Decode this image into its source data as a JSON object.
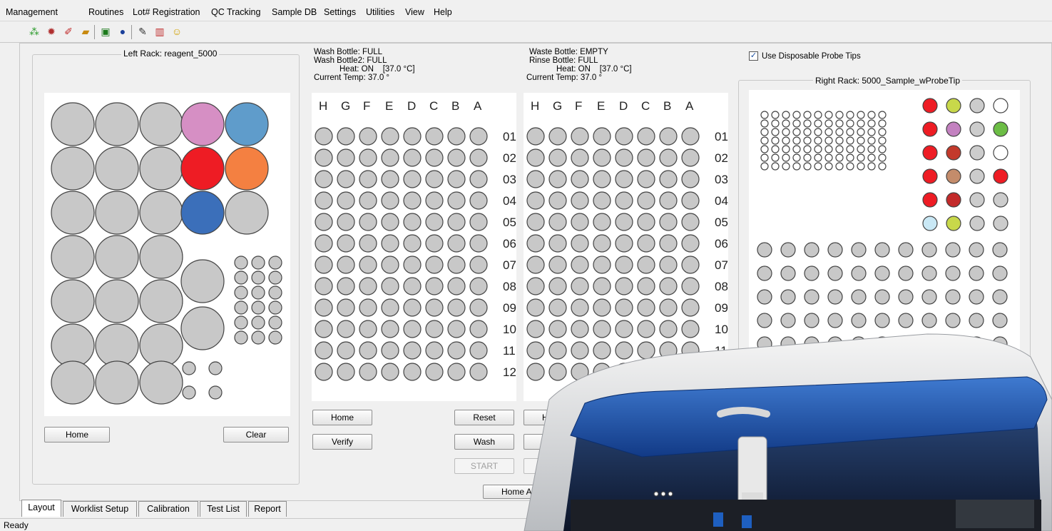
{
  "menu": [
    "Management",
    "Routines",
    "Lot# Registration",
    "QC Tracking",
    "Sample DB",
    "Settings",
    "Utilities",
    "View",
    "Help"
  ],
  "toolbar_icons": [
    "connect-icon",
    "gear-icon",
    "tools-icon",
    "open-folder-icon",
    "monitor-icon",
    "info-icon",
    "edit-icon",
    "chart-icon",
    "smiley-icon"
  ],
  "left_rack": {
    "title": "Left Rack: reagent_5000",
    "home_label": "Home",
    "clear_label": "Clear",
    "colored_wells": {
      "pink": "#d68fc4",
      "lightblue": "#5f9ccb",
      "red": "#ee1c24",
      "orange": "#f48041",
      "blue": "#3b6fba"
    }
  },
  "wash_status": {
    "line1": "Wash Bottle: FULL",
    "line2": "Wash Bottle2: FULL",
    "line3": "Heat: ON    [37.0 °C]",
    "line4": "Current Temp: 37.0 °"
  },
  "waste_status": {
    "line1": "Waste Bottle: EMPTY",
    "line2": "Rinse Bottle: FULL",
    "line3": "Heat: ON    [37.0 °C]",
    "line4": "Current Temp: 37.0 °"
  },
  "plate_columns": [
    "H",
    "G",
    "F",
    "E",
    "D",
    "C",
    "B",
    "A"
  ],
  "plate_rows": [
    "01",
    "02",
    "03",
    "04",
    "05",
    "06",
    "07",
    "08",
    "09",
    "10",
    "11",
    "12"
  ],
  "plate1_buttons": {
    "home": "Home",
    "reset": "Reset",
    "verify": "Verify",
    "wash": "Wash",
    "start": "START"
  },
  "plate2_buttons": {
    "home": "Home",
    "verify": "Ve"
  },
  "home_all_label": "Home All Mo",
  "use_disposable": {
    "label": "Use Disposable Probe Tips",
    "checked": true
  },
  "right_rack": {
    "title": "Right Rack: 5000_Sample_wProbeTip",
    "colored_grid": [
      [
        "#ee1c24",
        "#c8d84a",
        "#cccccc",
        "#ffffff"
      ],
      [
        "#ee1c24",
        "#c381c0",
        "#cccccc",
        "#6cbd45"
      ],
      [
        "#ee1c24",
        "#c3392b",
        "#cccccc",
        "#ffffff"
      ],
      [
        "#ee1c24",
        "#c48c6b",
        "#cccccc",
        "#ee1c24"
      ],
      [
        "#ee1c24",
        "#c32a2a",
        "#cccccc",
        "#cccccc"
      ],
      [
        "#c9e8f5",
        "#c8d84a",
        "#cccccc",
        "#cccccc"
      ]
    ]
  },
  "tabs": [
    "Layout",
    "Worklist Setup",
    "Calibration",
    "Test List",
    "Report"
  ],
  "status_text": "Ready"
}
